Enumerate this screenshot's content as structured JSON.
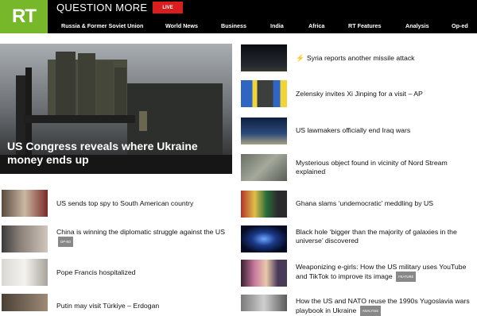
{
  "header": {
    "logo": "RT",
    "tagline": "QUESTION MORE",
    "live_label": "LIVE",
    "nav": [
      "Russia & Former Soviet Union",
      "World News",
      "Business",
      "India",
      "Africa",
      "RT Features",
      "Analysis",
      "Op-ed"
    ]
  },
  "hero": {
    "title": "US Congress reveals where Ukraine money ends up"
  },
  "left_list": [
    {
      "title": "US sends top spy to South American country"
    },
    {
      "title": "China is winning the diplomatic struggle against the US",
      "badge": "OP-ED"
    },
    {
      "title": "Pope Francis hospitalized"
    },
    {
      "title": "Putin may visit Türkiye – Erdogan"
    }
  ],
  "right_list": [
    {
      "title": "Syria reports another missile attack",
      "flash": "⚡"
    },
    {
      "title": "Zelensky invites Xi Jinping for a visit – AP"
    },
    {
      "title": "US lawmakers officially end Iraq wars"
    },
    {
      "title": "Mysterious object found in vicinity of Nord Stream explained"
    },
    {
      "title": "Ghana slams ‘undemocratic’ meddling by US"
    },
    {
      "title": "Black hole ‘bigger than the majority of galaxies in the universe’ discovered"
    },
    {
      "title": "Weaponizing e-girls: How the US military uses YouTube and TikTok to improve its image",
      "badge": "FEATURE"
    },
    {
      "title": "How the US and NATO reuse the 1990s Yugoslavia wars playbook in Ukraine",
      "badge": "ANALYSIS"
    }
  ],
  "colors": {
    "brand_green": "#76b82a",
    "live_red": "#d81e1e",
    "flash_red": "#e21b1b",
    "badge_gray": "#888888"
  }
}
